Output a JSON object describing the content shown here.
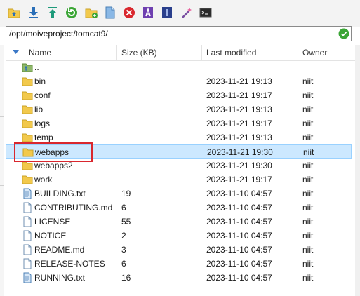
{
  "toolbar": {
    "buttons": [
      {
        "name": "parent-folder-button",
        "icon": "folder-up-icon"
      },
      {
        "name": "download-button",
        "icon": "download-arrow-icon"
      },
      {
        "name": "upload-button",
        "icon": "upload-arrow-icon"
      },
      {
        "name": "refresh-button",
        "icon": "refresh-icon"
      },
      {
        "name": "new-folder-button",
        "icon": "new-folder-icon"
      },
      {
        "name": "new-file-button",
        "icon": "new-file-icon"
      },
      {
        "name": "delete-button",
        "icon": "delete-icon"
      },
      {
        "name": "rename-button",
        "icon": "rename-icon"
      },
      {
        "name": "properties-button",
        "icon": "properties-icon"
      },
      {
        "name": "wand-button",
        "icon": "magic-wand-icon"
      },
      {
        "name": "terminal-button",
        "icon": "terminal-icon"
      }
    ]
  },
  "path": {
    "value": "/opt/moiveproject/tomcat9/",
    "status_icon": "check-icon",
    "status_color": "#3aa535"
  },
  "columns": {
    "name": "Name",
    "size": "Size (KB)",
    "modified": "Last modified",
    "owner": "Owner"
  },
  "files": [
    {
      "name": "..",
      "size": "",
      "modified": "",
      "owner": "",
      "type": "parent"
    },
    {
      "name": "bin",
      "size": "",
      "modified": "2023-11-21 19:13",
      "owner": "niit",
      "type": "folder"
    },
    {
      "name": "conf",
      "size": "",
      "modified": "2023-11-21 19:17",
      "owner": "niit",
      "type": "folder"
    },
    {
      "name": "lib",
      "size": "",
      "modified": "2023-11-21 19:13",
      "owner": "niit",
      "type": "folder"
    },
    {
      "name": "logs",
      "size": "",
      "modified": "2023-11-21 19:17",
      "owner": "niit",
      "type": "folder"
    },
    {
      "name": "temp",
      "size": "",
      "modified": "2023-11-21 19:13",
      "owner": "niit",
      "type": "folder"
    },
    {
      "name": "webapps",
      "size": "",
      "modified": "2023-11-21 19:30",
      "owner": "niit",
      "type": "folder",
      "selected": true
    },
    {
      "name": "webapps2",
      "size": "",
      "modified": "2023-11-21 19:30",
      "owner": "niit",
      "type": "folder"
    },
    {
      "name": "work",
      "size": "",
      "modified": "2023-11-21 19:17",
      "owner": "niit",
      "type": "folder"
    },
    {
      "name": "BUILDING.txt",
      "size": "19",
      "modified": "2023-11-10 04:57",
      "owner": "niit",
      "type": "text-file"
    },
    {
      "name": "CONTRIBUTING.md",
      "size": "6",
      "modified": "2023-11-10 04:57",
      "owner": "niit",
      "type": "file"
    },
    {
      "name": "LICENSE",
      "size": "55",
      "modified": "2023-11-10 04:57",
      "owner": "niit",
      "type": "file"
    },
    {
      "name": "NOTICE",
      "size": "2",
      "modified": "2023-11-10 04:57",
      "owner": "niit",
      "type": "file"
    },
    {
      "name": "README.md",
      "size": "3",
      "modified": "2023-11-10 04:57",
      "owner": "niit",
      "type": "file"
    },
    {
      "name": "RELEASE-NOTES",
      "size": "6",
      "modified": "2023-11-10 04:57",
      "owner": "niit",
      "type": "file"
    },
    {
      "name": "RUNNING.txt",
      "size": "16",
      "modified": "2023-11-10 04:57",
      "owner": "niit",
      "type": "text-file"
    }
  ],
  "colors": {
    "selection": "#cce8ff",
    "highlight_box": "#d9272e",
    "folder": "#f2c94c"
  }
}
